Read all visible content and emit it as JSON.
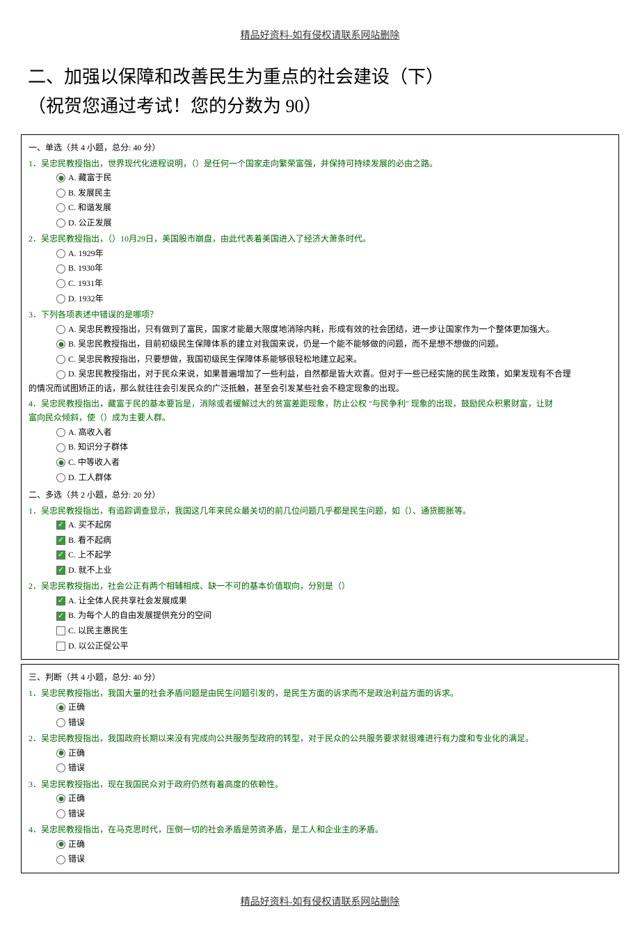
{
  "header_note": "精品好资料-如有侵权请联系网站删除",
  "footer_note": "精品好资料-如有侵权请联系网站删除",
  "main_title": "二、加强以保障和改善民生为重点的社会建设（下）",
  "sub_title": "（祝贺您通过考试！您的分数为 90）",
  "sections": {
    "s1": {
      "title": "一、单选（共 4 小题，总分: 40 分）",
      "q1": {
        "text": "1．吴忠民教授指出，世界现代化进程说明，（）是任何一个国家走向繁荣富强，并保持可持续发展的必由之路。",
        "a": "A. 藏富于民",
        "b": "B. 发展民主",
        "c": "C. 和谐发展",
        "d": "D. 公正发展"
      },
      "q2": {
        "text": "2．吴忠民教授指出，（）10月29日，美国股市崩盘，由此代表着美国进入了经济大萧条时代。",
        "a": "A. 1929年",
        "b": "B. 1930年",
        "c": "C. 1931年",
        "d": "D. 1932年"
      },
      "q3": {
        "text": "3．下列各项表述中错误的是哪项？",
        "a": "A. 吴忠民教授指出，只有做到了富民，国家才能最大限度地消除内耗，形成有效的社会团结，进一步让国家作为一个整体更加强大。",
        "b": "B. 吴忠民教授指出，目前初级民生保障体系的建立对我国来说，仍是一个能不能够做的问题，而不是想不想做的问题。",
        "c": "C. 吴忠民教授指出，只要想做，我国初级民生保障体系能够很轻松地建立起来。",
        "d": "D. 吴忠民教授指出，对于民众来说，如果普遍增加了一些利益，自然都是皆大欢喜。但对于一些已经实施的民生政策，如果发现有不合理",
        "d_cont": "的情况而试图矫正的话，那么就往往会引发民众的广泛抵触，甚至会引发某些社会不稳定现象的出现。"
      },
      "q4": {
        "text": "4．吴忠民教授指出，藏富于民的基本要旨是，消除或者缓解过大的贫富差距现象，防止公权 \"与民争利\" 现象的出现，鼓励民众积累财富，让财",
        "text_cont": "富向民众倾斜，使（）成为主要人群。",
        "a": "A. 高收入者",
        "b": "B. 知识分子群体",
        "c": "C. 中等收入者",
        "d": "D. 工人群体"
      }
    },
    "s2": {
      "title": "二、多选（共 2 小题，总分: 20 分）",
      "q1": {
        "text": "1．吴忠民教授指出，有追踪调查显示，我国这几年来民众最关切的前几位问题几乎都是民生问题，如（）、通货膨胀等。",
        "a": "A. 买不起房",
        "b": "B. 看不起病",
        "c": "C. 上不起学",
        "d": "D. 就不上业"
      },
      "q2": {
        "text": "2．吴忠民教授指出，社会公正有两个相辅相成、缺一不可的基本价值取向，分别是（）",
        "a": "A. 让全体人民共享社会发展成果",
        "b": "B. 为每个人的自由发展提供充分的空间",
        "c": "C. 以民主惠民生",
        "d": "D. 以公正促公平"
      }
    },
    "s3": {
      "title": "三、判断（共 4 小题，总分: 40 分）",
      "q1": {
        "text": "1．吴忠民教授指出，我国大量的社会矛盾问题是由民生问题引发的，是民生方面的诉求而不是政治利益方面的诉求。",
        "a": "正确",
        "b": "错误"
      },
      "q2": {
        "text": "2．吴忠民教授指出，我国政府长期以来没有完成向公共服务型政府的转型，对于民众的公共服务要求就很难进行有力度和专业化的满足。",
        "a": "正确",
        "b": "错误"
      },
      "q3": {
        "text": "3．吴忠民教授指出，现在我国民众对于政府仍然有着高度的依赖性。",
        "a": "正确",
        "b": "错误"
      },
      "q4": {
        "text": "4．吴忠民教授指出，在马克思时代，压倒一切的社会矛盾是劳资矛盾，是工人和企业主的矛盾。",
        "a": "正确",
        "b": "错误"
      }
    }
  }
}
